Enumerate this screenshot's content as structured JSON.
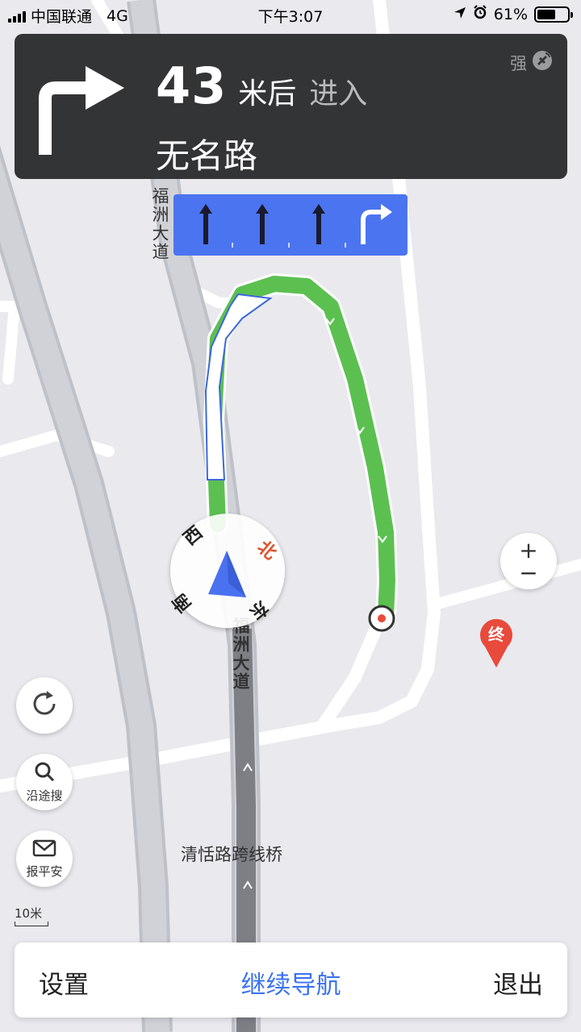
{
  "status_bar": {
    "carrier": "中国联通",
    "network": "4G",
    "time": "下午3:07",
    "battery": "61%",
    "battery_level": 0.61
  },
  "nav": {
    "distance_value": "43",
    "distance_unit": "米后",
    "action": "进入",
    "road_name": "无名路",
    "gps_label": "强",
    "lanes": [
      "straight",
      "straight",
      "straight",
      "right-turn"
    ]
  },
  "map": {
    "road_label_top": "福洲大道",
    "road_label_bottom": "福洲大道",
    "bridge_label": "清恬路跨线桥",
    "destination_label": "终",
    "scale": "10米"
  },
  "compass": {
    "north": "北",
    "south": "南",
    "east": "东",
    "west": "西"
  },
  "side_buttons": {
    "recenter_icon": "refresh-icon",
    "search_along": "沿途搜",
    "report_safe": "报平安"
  },
  "zoom": {
    "in": "+",
    "out": "−"
  },
  "bottom_bar": {
    "settings": "设置",
    "continue": "继续导航",
    "exit": "退出"
  },
  "colors": {
    "route_green": "#5cc051",
    "accent_blue": "#4b74f0",
    "banner_bg": "#333435",
    "destination_red": "#e84a3b"
  }
}
